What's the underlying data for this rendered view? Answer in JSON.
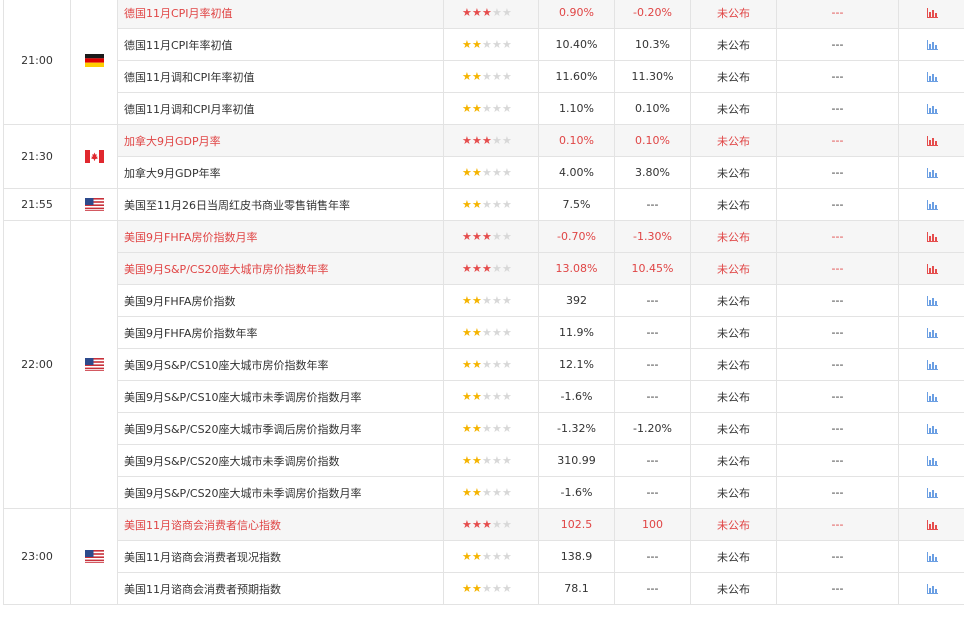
{
  "groups": [
    {
      "time": "21:00",
      "flag": "de",
      "rows": [
        {
          "name": "德国11月CPI月率初值",
          "importance": 3,
          "previous": "0.90%",
          "forecast": "-0.20%",
          "status": "未公布",
          "actual": "---",
          "highlight": true
        },
        {
          "name": "德国11月CPI年率初值",
          "importance": 2,
          "previous": "10.40%",
          "forecast": "10.3%",
          "status": "未公布",
          "actual": "---",
          "highlight": false
        },
        {
          "name": "德国11月调和CPI年率初值",
          "importance": 2,
          "previous": "11.60%",
          "forecast": "11.30%",
          "status": "未公布",
          "actual": "---",
          "highlight": false
        },
        {
          "name": "德国11月调和CPI月率初值",
          "importance": 2,
          "previous": "1.10%",
          "forecast": "0.10%",
          "status": "未公布",
          "actual": "---",
          "highlight": false
        }
      ]
    },
    {
      "time": "21:30",
      "flag": "ca",
      "rows": [
        {
          "name": "加拿大9月GDP月率",
          "importance": 3,
          "previous": "0.10%",
          "forecast": "0.10%",
          "status": "未公布",
          "actual": "---",
          "highlight": true
        },
        {
          "name": "加拿大9月GDP年率",
          "importance": 2,
          "previous": "4.00%",
          "forecast": "3.80%",
          "status": "未公布",
          "actual": "---",
          "highlight": false
        }
      ]
    },
    {
      "time": "21:55",
      "flag": "us",
      "rows": [
        {
          "name": "美国至11月26日当周红皮书商业零售销售年率",
          "importance": 2,
          "previous": "7.5%",
          "forecast": "---",
          "status": "未公布",
          "actual": "---",
          "highlight": false
        }
      ]
    },
    {
      "time": "22:00",
      "flag": "us",
      "rows": [
        {
          "name": "美国9月FHFA房价指数月率",
          "importance": 3,
          "previous": "-0.70%",
          "forecast": "-1.30%",
          "status": "未公布",
          "actual": "---",
          "highlight": true
        },
        {
          "name": "美国9月S&P/CS20座大城市房价指数年率",
          "importance": 3,
          "previous": "13.08%",
          "forecast": "10.45%",
          "status": "未公布",
          "actual": "---",
          "highlight": true
        },
        {
          "name": "美国9月FHFA房价指数",
          "importance": 2,
          "previous": "392",
          "forecast": "---",
          "status": "未公布",
          "actual": "---",
          "highlight": false
        },
        {
          "name": "美国9月FHFA房价指数年率",
          "importance": 2,
          "previous": "11.9%",
          "forecast": "---",
          "status": "未公布",
          "actual": "---",
          "highlight": false
        },
        {
          "name": "美国9月S&P/CS10座大城市房价指数年率",
          "importance": 2,
          "previous": "12.1%",
          "forecast": "---",
          "status": "未公布",
          "actual": "---",
          "highlight": false
        },
        {
          "name": "美国9月S&P/CS10座大城市未季调房价指数月率",
          "importance": 2,
          "previous": "-1.6%",
          "forecast": "---",
          "status": "未公布",
          "actual": "---",
          "highlight": false
        },
        {
          "name": "美国9月S&P/CS20座大城市季调后房价指数月率",
          "importance": 2,
          "previous": "-1.32%",
          "forecast": "-1.20%",
          "status": "未公布",
          "actual": "---",
          "highlight": false
        },
        {
          "name": "美国9月S&P/CS20座大城市未季调房价指数",
          "importance": 2,
          "previous": "310.99",
          "forecast": "---",
          "status": "未公布",
          "actual": "---",
          "highlight": false
        },
        {
          "name": "美国9月S&P/CS20座大城市未季调房价指数月率",
          "importance": 2,
          "previous": "-1.6%",
          "forecast": "---",
          "status": "未公布",
          "actual": "---",
          "highlight": false
        }
      ]
    },
    {
      "time": "23:00",
      "flag": "us",
      "rows": [
        {
          "name": "美国11月谘商会消费者信心指数",
          "importance": 3,
          "previous": "102.5",
          "forecast": "100",
          "status": "未公布",
          "actual": "---",
          "highlight": true
        },
        {
          "name": "美国11月谘商会消费者现况指数",
          "importance": 2,
          "previous": "138.9",
          "forecast": "---",
          "status": "未公布",
          "actual": "---",
          "highlight": false
        },
        {
          "name": "美国11月谘商会消费者预期指数",
          "importance": 2,
          "previous": "78.1",
          "forecast": "---",
          "status": "未公布",
          "actual": "---",
          "highlight": false
        }
      ]
    }
  ],
  "colors": {
    "highlight_text": "#e04545",
    "highlight_bg": "#f6f6f6",
    "star_gold": "#f5b400",
    "star_red": "#e54d4d",
    "star_grey": "#d8d8d8",
    "chart_blue": "#6b9fe3",
    "chart_red": "#e54d4d"
  },
  "icons": {
    "flag_de": "germany-flag-icon",
    "flag_ca": "canada-flag-icon",
    "flag_us": "usa-flag-icon",
    "chart": "bar-chart-icon",
    "star": "star-icon"
  }
}
